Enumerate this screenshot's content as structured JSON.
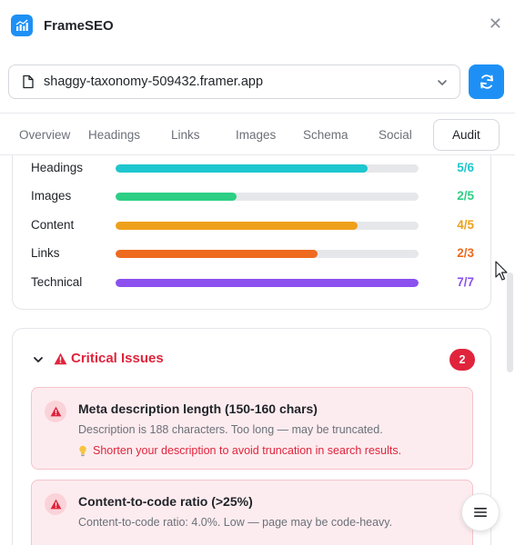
{
  "app": {
    "title": "FrameSEO",
    "logo_icon": "chart-logo-icon"
  },
  "url_select": {
    "value": "shaggy-taxonomy-509432.framer.app"
  },
  "tabs": [
    {
      "label": "Overview",
      "active": false
    },
    {
      "label": "Headings",
      "active": false
    },
    {
      "label": "Links",
      "active": false
    },
    {
      "label": "Images",
      "active": false
    },
    {
      "label": "Schema",
      "active": false
    },
    {
      "label": "Social",
      "active": false
    },
    {
      "label": "Audit",
      "active": true
    }
  ],
  "scores": [
    {
      "label": "Headings",
      "value": "5/6",
      "fraction": 0.833,
      "color": "#1ec6cf"
    },
    {
      "label": "Images",
      "value": "2/5",
      "fraction": 0.4,
      "color": "#2ccf84"
    },
    {
      "label": "Content",
      "value": "4/5",
      "fraction": 0.8,
      "color": "#eea01b"
    },
    {
      "label": "Links",
      "value": "2/3",
      "fraction": 0.667,
      "color": "#ee6a1f"
    },
    {
      "label": "Technical",
      "value": "7/7",
      "fraction": 1.0,
      "color": "#8b50ee"
    }
  ],
  "critical": {
    "title": "Critical Issues",
    "count": "2",
    "color": "#e0243c",
    "issues": [
      {
        "title": "Meta description length (150-160 chars)",
        "description": "Description is 188 characters. Too long — may be truncated.",
        "tip": "Shorten your description to avoid truncation in search results."
      },
      {
        "title": "Content-to-code ratio (>25%)",
        "description": "Content-to-code ratio: 4.0%. Low — page may be code-heavy."
      }
    ]
  },
  "colors": {
    "accent": "#1e90f5",
    "danger": "#e0243c"
  }
}
